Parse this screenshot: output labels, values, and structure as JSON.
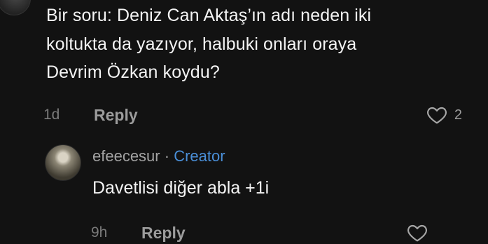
{
  "top_comment": {
    "text": "Bir soru: Deniz Can Aktaş’ın adı neden iki\nkoltukta da yazıyor, halbuki onları oraya\nDevrim Özkan koydu?",
    "time": "1d",
    "reply_label": "Reply",
    "like_count": "2",
    "like_icon": "heart-outline-icon"
  },
  "reply_comment": {
    "username": "efeecesur",
    "separator": " · ",
    "badge": "Creator",
    "badge_color": "#4a8fd8",
    "text": "Davetlisi diğer abla +1i",
    "time": "9h",
    "reply_label": "Reply",
    "like_icon": "heart-outline-icon"
  }
}
